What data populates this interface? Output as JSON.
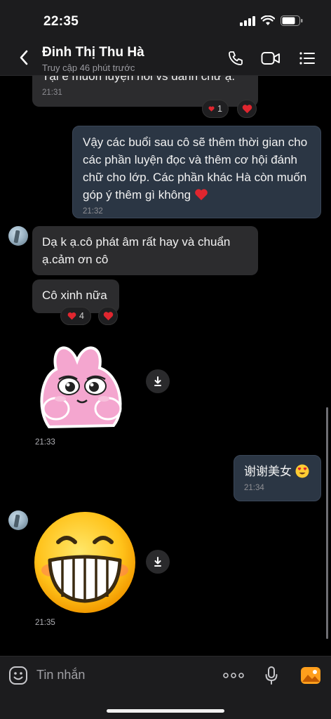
{
  "status": {
    "time": "22:35"
  },
  "header": {
    "name": "Đinh Thị Thu Hà",
    "subtitle": "Truy cập 46 phút trước"
  },
  "messages": {
    "m1": {
      "text": "Tại e muốn luyện nói vs đánh chữ ạ.",
      "time": "21:31"
    },
    "m1_reaction_count": "1",
    "m2": {
      "text": "Vậy các buổi sau cô sẽ thêm thời gian cho các phần luyện đọc và thêm cơ hội đánh chữ cho lớp. Các phần khác Hà còn muốn góp ý thêm gì không",
      "time": "21:32"
    },
    "m3": {
      "text": "Dạ k ạ.cô phát âm rất hay và chuẩn ạ.cảm ơn cô"
    },
    "m4": {
      "text": "Cô xinh nữa"
    },
    "m4_reaction_count": "4",
    "sticker1_time": "21:33",
    "m5": {
      "text": "谢谢美女",
      "time": "21:34"
    },
    "sticker2_time": "21:35"
  },
  "composer": {
    "placeholder": "Tin nhắn"
  },
  "colors": {
    "background": "#000000",
    "incoming_bubble": "#2c2c2e",
    "outgoing_bubble": "#2b3644",
    "heart": "#e0262f",
    "accent_orange": "#ff9f1c"
  },
  "icons": [
    "back-icon",
    "phone-icon",
    "video-call-icon",
    "menu-list-icon",
    "download-icon",
    "emoji-icon",
    "more-icon",
    "microphone-icon",
    "image-icon"
  ]
}
